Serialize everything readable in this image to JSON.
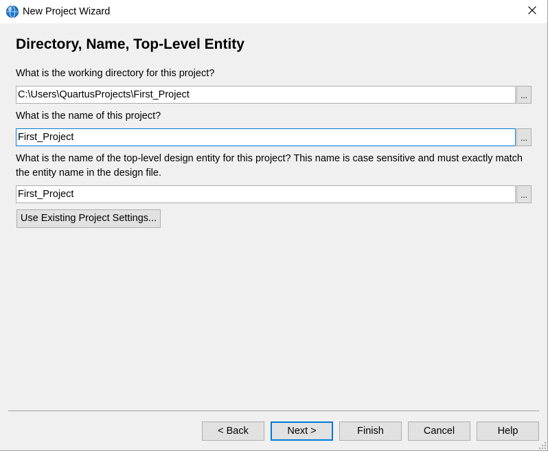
{
  "window": {
    "title": "New Project Wizard"
  },
  "page": {
    "heading": "Directory, Name, Top-Level Entity"
  },
  "directory": {
    "label": "What is the working directory for this project?",
    "value": "C:\\Users\\QuartusProjects\\First_Project",
    "browse_label": "..."
  },
  "project_name": {
    "label": "What is the name of this project?",
    "value": "First_Project",
    "browse_label": "..."
  },
  "top_level": {
    "label": "What is the name of the top-level design entity for this project? This name is case sensitive and must exactly match the entity name in the design file.",
    "value": "First_Project",
    "browse_label": "..."
  },
  "existing_settings_button": "Use Existing Project Settings...",
  "footer": {
    "back": "< Back",
    "next": "Next >",
    "finish": "Finish",
    "cancel": "Cancel",
    "help": "Help"
  },
  "colors": {
    "accent": "#0078d7",
    "window_bg": "#f0f0f0",
    "button_bg": "#e1e1e1"
  },
  "icons": {
    "app": "quartus-globe-icon",
    "close": "close-icon",
    "resize": "resize-grip-icon"
  }
}
